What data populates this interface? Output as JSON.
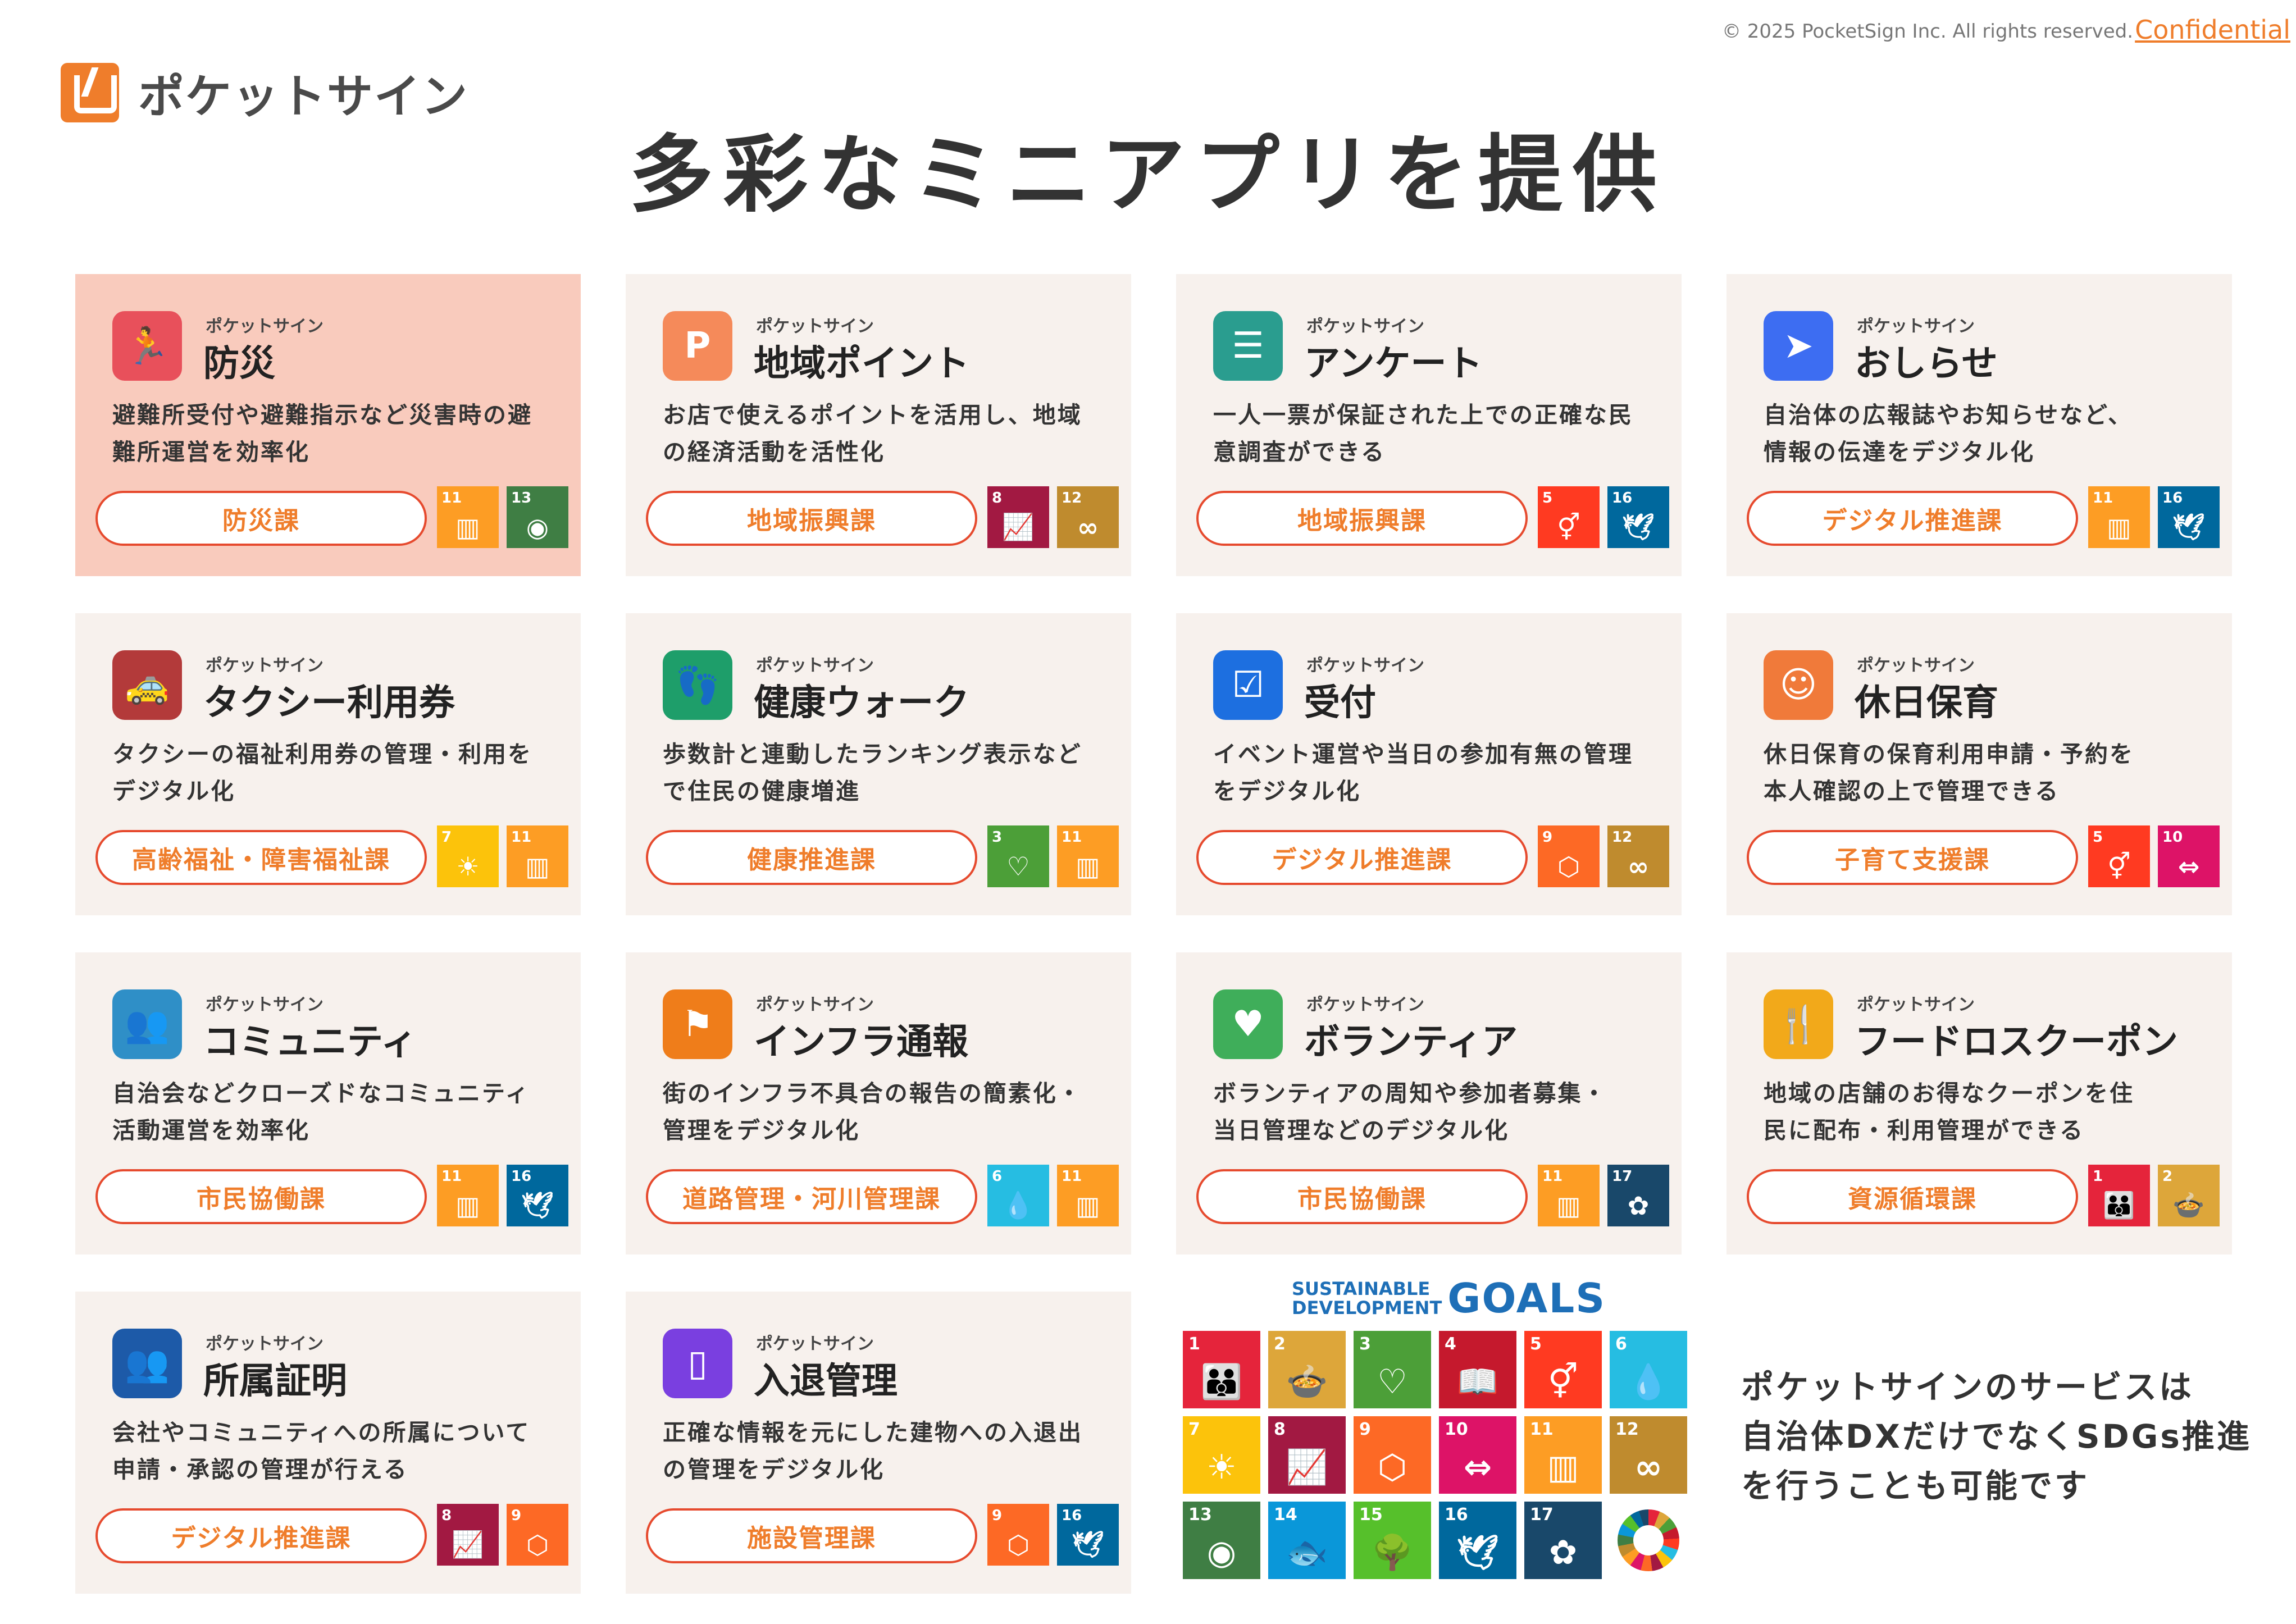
{
  "header": {
    "copyright": "© 2025 PocketSign Inc. All rights reserved.",
    "confidential": "Confidential",
    "logo_text": "ポケットサイン",
    "title": "多彩なミニアプリを提供"
  },
  "cards": [
    {
      "brand": "ポケットサイン",
      "title": "防災",
      "desc_line1": "避難所受付や避難指示など災害時の避",
      "desc_line2": "難所運営を効率化",
      "dept": "防災課",
      "icon": "running-person-icon",
      "icon_glyph": "🏃",
      "icon_color": "#e8505b",
      "highlight": true,
      "sdg1": {
        "num": "11",
        "color": "#fd9d24",
        "glyph": "▥",
        "icon": "city-icon"
      },
      "sdg2": {
        "num": "13",
        "color": "#3f7e44",
        "glyph": "◉",
        "icon": "eye-globe-icon"
      }
    },
    {
      "brand": "ポケットサイン",
      "title": "地域ポイント",
      "desc_line1": "お店で使えるポイントを活用し、地域",
      "desc_line2": "の経済活動を活性化",
      "dept": "地域振興課",
      "icon": "point-coin-icon",
      "icon_glyph": "P",
      "icon_color": "#f58a5a",
      "sdg1": {
        "num": "8",
        "color": "#a21942",
        "glyph": "📈",
        "icon": "growth-chart-icon"
      },
      "sdg2": {
        "num": "12",
        "color": "#bf8b2e",
        "glyph": "∞",
        "icon": "infinity-icon"
      }
    },
    {
      "brand": "ポケットサイン",
      "title": "アンケート",
      "desc_line1": "一人一票が保証された上での正確な民",
      "desc_line2": "意調査ができる",
      "dept": "地域振興課",
      "icon": "survey-chat-icon",
      "icon_glyph": "☰",
      "icon_color": "#2a9d8f",
      "sdg1": {
        "num": "5",
        "color": "#ff3a21",
        "glyph": "⚥",
        "icon": "gender-icon"
      },
      "sdg2": {
        "num": "16",
        "color": "#00689d",
        "glyph": "🕊",
        "icon": "dove-icon"
      }
    },
    {
      "brand": "ポケットサイン",
      "title": "おしらせ",
      "desc_line1": "自治体の広報誌やお知らせなど、",
      "desc_line2": "情報の伝達をデジタル化",
      "dept": "デジタル推進課",
      "icon": "paper-plane-icon",
      "icon_glyph": "➤",
      "icon_color": "#3d6df2",
      "sdg1": {
        "num": "11",
        "color": "#fd9d24",
        "glyph": "▥",
        "icon": "city-icon"
      },
      "sdg2": {
        "num": "16",
        "color": "#00689d",
        "glyph": "🕊",
        "icon": "dove-icon"
      }
    },
    {
      "brand": "ポケットサイン",
      "title": "タクシー利用券",
      "desc_line1": "タクシーの福祉利用券の管理・利用を",
      "desc_line2": "デジタル化",
      "dept": "高齢福祉・障害福祉課",
      "icon": "taxi-icon",
      "icon_glyph": "🚕",
      "icon_color": "#b33a3a",
      "sdg1": {
        "num": "7",
        "color": "#fcc30b",
        "glyph": "☀",
        "icon": "sun-icon"
      },
      "sdg2": {
        "num": "11",
        "color": "#fd9d24",
        "glyph": "▥",
        "icon": "city-icon"
      }
    },
    {
      "brand": "ポケットサイン",
      "title": "健康ウォーク",
      "desc_line1": "歩数計と連動したランキング表示など",
      "desc_line2": "で住民の健康増進",
      "dept": "健康推進課",
      "icon": "footprints-icon",
      "icon_glyph": "👣",
      "icon_color": "#1e9e6a",
      "sdg1": {
        "num": "3",
        "color": "#4c9f38",
        "glyph": "♡",
        "icon": "heartbeat-icon"
      },
      "sdg2": {
        "num": "11",
        "color": "#fd9d24",
        "glyph": "▥",
        "icon": "city-icon"
      }
    },
    {
      "brand": "ポケットサイン",
      "title": "受付",
      "desc_line1": "イベント運営や当日の参加有無の管理",
      "desc_line2": "をデジタル化",
      "dept": "デジタル推進課",
      "icon": "calendar-check-icon",
      "icon_glyph": "☑",
      "icon_color": "#1d6fe0",
      "sdg1": {
        "num": "9",
        "color": "#fd6925",
        "glyph": "⬡",
        "icon": "cubes-icon"
      },
      "sdg2": {
        "num": "12",
        "color": "#bf8b2e",
        "glyph": "∞",
        "icon": "infinity-icon"
      }
    },
    {
      "brand": "ポケットサイン",
      "title": "休日保育",
      "desc_line1": "休日保育の保育利用申請・予約を",
      "desc_line2": "本人確認の上で管理できる",
      "dept": "子育て支援課",
      "icon": "baby-face-icon",
      "icon_glyph": "☺",
      "icon_color": "#f07a3a",
      "sdg1": {
        "num": "5",
        "color": "#ff3a21",
        "glyph": "⚥",
        "icon": "gender-icon"
      },
      "sdg2": {
        "num": "10",
        "color": "#dd1367",
        "glyph": "⇔",
        "icon": "equality-arrows-icon"
      }
    },
    {
      "brand": "ポケットサイン",
      "title": "コミュニティ",
      "desc_line1": "自治会などクローズドなコミュニティ",
      "desc_line2": "活動運営を効率化",
      "dept": "市民協働課",
      "icon": "community-people-icon",
      "icon_glyph": "👥",
      "icon_color": "#2f8fc7",
      "sdg1": {
        "num": "11",
        "color": "#fd9d24",
        "glyph": "▥",
        "icon": "city-icon"
      },
      "sdg2": {
        "num": "16",
        "color": "#00689d",
        "glyph": "🕊",
        "icon": "dove-icon"
      }
    },
    {
      "brand": "ポケットサイン",
      "title": "インフラ通報",
      "desc_line1": "街のインフラ不具合の報告の簡素化・",
      "desc_line2": "管理をデジタル化",
      "dept": "道路管理・河川管理課",
      "icon": "flag-icon",
      "icon_glyph": "⚑",
      "icon_color": "#ef7d1a",
      "sdg1": {
        "num": "6",
        "color": "#26bde2",
        "glyph": "💧",
        "icon": "water-drop-icon"
      },
      "sdg2": {
        "num": "11",
        "color": "#fd9d24",
        "glyph": "▥",
        "icon": "city-icon"
      }
    },
    {
      "brand": "ポケットサイン",
      "title": "ボランティア",
      "desc_line1": "ボランティアの周知や参加者募集・",
      "desc_line2": "当日管理などのデジタル化",
      "dept": "市民協働課",
      "icon": "heart-hand-icon",
      "icon_glyph": "♥",
      "icon_color": "#3fae5a",
      "sdg1": {
        "num": "11",
        "color": "#fd9d24",
        "glyph": "▥",
        "icon": "city-icon"
      },
      "sdg2": {
        "num": "17",
        "color": "#19486a",
        "glyph": "✿",
        "icon": "partnership-flower-icon"
      }
    },
    {
      "brand": "ポケットサイン",
      "title": "フードロスクーポン",
      "desc_line1": "地域の店舗のお得なクーポンを住",
      "desc_line2": "民に配布・利用管理ができる",
      "dept": "資源循環課",
      "icon": "food-coupon-icon",
      "icon_glyph": "🍴",
      "icon_color": "#f2a91a",
      "sdg1": {
        "num": "1",
        "color": "#e5243b",
        "glyph": "👪",
        "icon": "family-icon"
      },
      "sdg2": {
        "num": "2",
        "color": "#dda63a",
        "glyph": "🍲",
        "icon": "bowl-icon"
      }
    },
    {
      "brand": "ポケットサイン",
      "title": "所属証明",
      "desc_line1": "会社やコミュニティへの所属について",
      "desc_line2": "申請・承認の管理が行える",
      "dept": "デジタル推進課",
      "icon": "membership-people-icon",
      "icon_glyph": "👥",
      "icon_color": "#1d5aa8",
      "sdg1": {
        "num": "8",
        "color": "#a21942",
        "glyph": "📈",
        "icon": "growth-chart-icon"
      },
      "sdg2": {
        "num": "9",
        "color": "#fd6925",
        "glyph": "⬡",
        "icon": "cubes-icon"
      }
    },
    {
      "brand": "ポケットサイン",
      "title": "入退管理",
      "desc_line1": "正確な情報を元にした建物への入退出",
      "desc_line2": "の管理をデジタル化",
      "dept": "施設管理課",
      "icon": "door-icon",
      "icon_glyph": "▯",
      "icon_color": "#7a3fe0",
      "sdg1": {
        "num": "9",
        "color": "#fd6925",
        "glyph": "⬡",
        "icon": "cubes-icon"
      },
      "sdg2": {
        "num": "16",
        "color": "#00689d",
        "glyph": "🕊",
        "icon": "dove-icon"
      }
    }
  ],
  "sdgs": {
    "logo_sub_line1": "SUSTAINABLE",
    "logo_sub_line2": "DEVELOPMENT",
    "logo_main": "GOALS",
    "tiles": [
      {
        "num": "1",
        "color": "#e5243b",
        "glyph": "👪",
        "icon": "family-icon"
      },
      {
        "num": "2",
        "color": "#dda63a",
        "glyph": "🍲",
        "icon": "bowl-icon"
      },
      {
        "num": "3",
        "color": "#4c9f38",
        "glyph": "♡",
        "icon": "heartbeat-icon"
      },
      {
        "num": "4",
        "color": "#c5192d",
        "glyph": "📖",
        "icon": "book-icon"
      },
      {
        "num": "5",
        "color": "#ff3a21",
        "glyph": "⚥",
        "icon": "gender-icon"
      },
      {
        "num": "6",
        "color": "#26bde2",
        "glyph": "💧",
        "icon": "water-drop-icon"
      },
      {
        "num": "7",
        "color": "#fcc30b",
        "glyph": "☀",
        "icon": "sun-icon"
      },
      {
        "num": "8",
        "color": "#a21942",
        "glyph": "📈",
        "icon": "growth-chart-icon"
      },
      {
        "num": "9",
        "color": "#fd6925",
        "glyph": "⬡",
        "icon": "cubes-icon"
      },
      {
        "num": "10",
        "color": "#dd1367",
        "glyph": "⇔",
        "icon": "equality-arrows-icon"
      },
      {
        "num": "11",
        "color": "#fd9d24",
        "glyph": "▥",
        "icon": "city-icon"
      },
      {
        "num": "12",
        "color": "#bf8b2e",
        "glyph": "∞",
        "icon": "infinity-icon"
      },
      {
        "num": "13",
        "color": "#3f7e44",
        "glyph": "◉",
        "icon": "eye-globe-icon"
      },
      {
        "num": "14",
        "color": "#0a97d9",
        "glyph": "🐟",
        "icon": "fish-icon"
      },
      {
        "num": "15",
        "color": "#56c02b",
        "glyph": "🌳",
        "icon": "tree-icon"
      },
      {
        "num": "16",
        "color": "#00689d",
        "glyph": "🕊",
        "icon": "dove-icon"
      },
      {
        "num": "17",
        "color": "#19486a",
        "glyph": "✿",
        "icon": "partnership-flower-icon"
      }
    ]
  },
  "promo": {
    "line1": "ポケットサインのサービスは",
    "line2": "自治体DXだけでなくSDGs推進",
    "line3": "を行うことも可能です"
  }
}
